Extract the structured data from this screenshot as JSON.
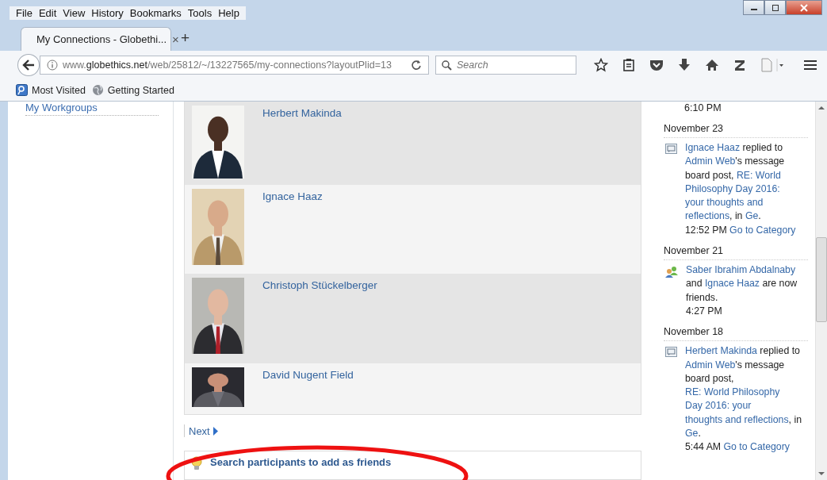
{
  "menu": [
    "File",
    "Edit",
    "View",
    "History",
    "Bookmarks",
    "Tools",
    "Help"
  ],
  "tabs": [
    {
      "title": "My Connections - Globethi...",
      "close": "×",
      "selected": true
    }
  ],
  "new_tab": "+",
  "url": {
    "prefix": "www.",
    "host": "globethics.net",
    "path": "/web/25812/~/13227565/my-connections?layoutPlid=13"
  },
  "search": {
    "placeholder": "Search"
  },
  "bookmarks": [
    "Most Visited",
    "Getting Started"
  ],
  "sidebar": {
    "items": [
      "My Workgroups"
    ]
  },
  "connections": [
    {
      "name": "Herbert Makinda"
    },
    {
      "name": "Ignace Haaz"
    },
    {
      "name": "Christoph Stückelberger"
    },
    {
      "name": "David Nugent Field"
    }
  ],
  "pager": {
    "next": "Next"
  },
  "search_tip": "Search participants to add as friends",
  "feed": [
    {
      "kind": "time",
      "text": "6:10 PM"
    },
    {
      "kind": "date",
      "text": "November 23"
    },
    {
      "kind": "reply",
      "segments": [
        {
          "kind": "link",
          "t": "Ignace Haaz"
        },
        {
          "kind": "text",
          "t": " replied to "
        },
        {
          "kind": "link",
          "t": "Admin Web"
        },
        {
          "kind": "text",
          "t": "'s message board post, "
        },
        {
          "kind": "link",
          "t": "RE: World"
        },
        {
          "kind": "link",
          "t": "Philosophy Day 2016:"
        },
        {
          "kind": "link",
          "t": "your thoughts and"
        },
        {
          "kind": "link",
          "t": "reflections"
        },
        {
          "kind": "text",
          "t": ", in "
        },
        {
          "kind": "link",
          "t": "Ge"
        },
        {
          "kind": "text",
          "t": "."
        }
      ],
      "time": "12:52 PM",
      "action": [
        "Go to",
        "Category"
      ]
    },
    {
      "kind": "date",
      "text": "November 21"
    },
    {
      "kind": "friendship",
      "segments": [
        {
          "kind": "link",
          "t": "Saber Ibrahim"
        },
        {
          "kind": "link",
          "t": "Abdalnaby"
        },
        {
          "kind": "text",
          "t": " and "
        },
        {
          "kind": "link",
          "t": "Ignace"
        },
        {
          "kind": "link",
          "t": "Haaz"
        },
        {
          "kind": "text",
          "t": " are now friends."
        }
      ],
      "time": "4:27 PM"
    },
    {
      "kind": "date",
      "text": "November 18"
    },
    {
      "kind": "reply",
      "segments": [
        {
          "kind": "link",
          "t": "Herbert Makinda"
        },
        {
          "kind": "text",
          "t": " replied to "
        },
        {
          "kind": "link",
          "t": "Admin Web"
        },
        {
          "kind": "text",
          "t": "'s message board post, "
        },
        {
          "kind": "link",
          "t": "RE: World Philosophy"
        },
        {
          "kind": "link",
          "t": "Day 2016: your"
        },
        {
          "kind": "link",
          "t": "thoughts and"
        },
        {
          "kind": "link",
          "t": "reflections"
        },
        {
          "kind": "text",
          "t": ", in "
        },
        {
          "kind": "link",
          "t": "Ge"
        },
        {
          "kind": "text",
          "t": "."
        }
      ],
      "time": "5:44 AM",
      "action": [
        "Go to Category"
      ]
    }
  ]
}
